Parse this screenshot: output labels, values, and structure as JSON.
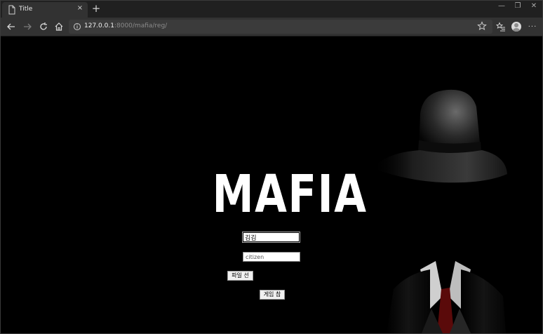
{
  "browser": {
    "tab_title": "Title",
    "tab_close": "×",
    "new_tab": "+",
    "window_controls": [
      "—",
      "❐",
      "✕"
    ],
    "url_host": "127.0.0.1",
    "url_path": ":8000/mafia/reg/",
    "more_label": "···"
  },
  "page": {
    "title": "MAFIA",
    "name_input_value": "김김",
    "role_input_value": "citizen",
    "file_button_label": "파일 선택",
    "join_button_label": "게임 참가"
  }
}
